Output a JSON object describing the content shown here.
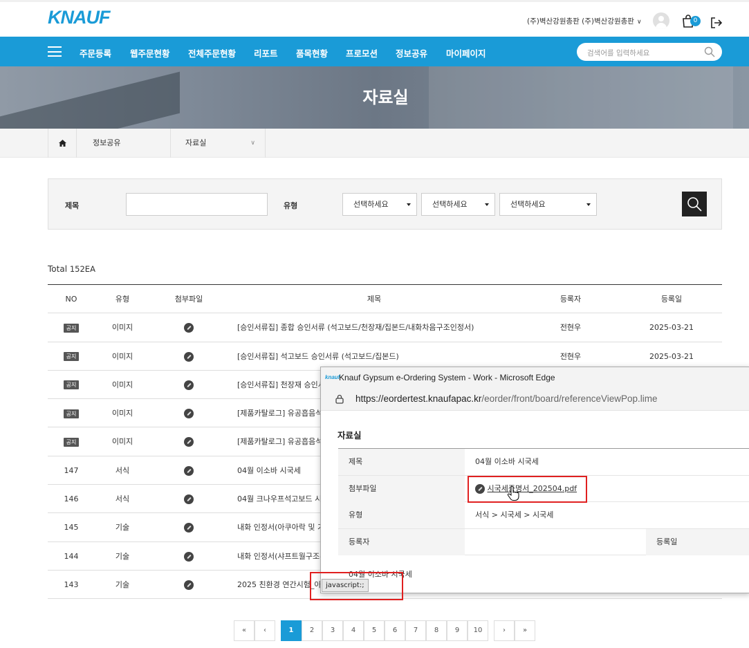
{
  "header": {
    "logo": "KNAUF",
    "account": "(주)벽산강원총판 (주)벽산강원총판",
    "cart_count": "0"
  },
  "nav": {
    "items": [
      "주문등록",
      "웹주문현황",
      "전체주문현황",
      "리포트",
      "품목현황",
      "프로모션",
      "정보공유",
      "마이페이지"
    ],
    "search_placeholder": "검색어를 입력하세요"
  },
  "hero": {
    "title": "자료실"
  },
  "breadcrumb": {
    "level1": "정보공유",
    "level2": "자료실"
  },
  "filter": {
    "title_label": "제목",
    "type_label": "유형",
    "selects": [
      "선택하세요",
      "선택하세요",
      "선택하세요"
    ]
  },
  "list": {
    "total_label": "Total",
    "total_value": "152EA",
    "headers": {
      "no": "NO",
      "type": "유형",
      "file": "첨부파일",
      "title": "제목",
      "author": "등록자",
      "date": "등록일"
    },
    "rows": [
      {
        "no": "공지",
        "notice": true,
        "type": "이미지",
        "title": "[승인서류집] 종합 승인서류 (석고보드/천장재/집본드/내화차음구조인정서)",
        "author": "전현우",
        "date": "2025-03-21"
      },
      {
        "no": "공지",
        "notice": true,
        "type": "이미지",
        "title": "[승인서류집] 석고보드 승인서류 (석고보드/집본드)",
        "author": "전현우",
        "date": "2025-03-21"
      },
      {
        "no": "공지",
        "notice": true,
        "type": "이미지",
        "title": "[승인서류집] 천장재 승인서",
        "author": "",
        "date": ""
      },
      {
        "no": "공지",
        "notice": true,
        "type": "이미지",
        "title": "[제품카탈로그] 유공흡음석",
        "author": "",
        "date": ""
      },
      {
        "no": "공지",
        "notice": true,
        "type": "이미지",
        "title": "[제품카탈로그] 유공흡음석",
        "author": "",
        "date": ""
      },
      {
        "no": "147",
        "notice": false,
        "type": "서식",
        "title": "04월 이소바 시국세",
        "author": "",
        "date": ""
      },
      {
        "no": "146",
        "notice": false,
        "type": "서식",
        "title": "04월 크나우프석고보드 시",
        "author": "",
        "date": ""
      },
      {
        "no": "145",
        "notice": false,
        "type": "기술",
        "title": "내화 인정서(아쿠아락 및 기",
        "author": "",
        "date": ""
      },
      {
        "no": "144",
        "notice": false,
        "type": "기술",
        "title": "내화 인정서(샤프트월구조-",
        "author": "",
        "date": ""
      },
      {
        "no": "143",
        "notice": false,
        "type": "기술",
        "title": "2025 친환경 연간시험_아",
        "author": "",
        "date": ""
      }
    ]
  },
  "pager": {
    "pages": [
      "1",
      "2",
      "3",
      "4",
      "5",
      "6",
      "7",
      "8",
      "9",
      "10"
    ],
    "first": "«",
    "prev": "‹",
    "next": "›",
    "last": "»"
  },
  "popup": {
    "window_title": "Knauf Gypsum e-Ordering System - Work - Microsoft Edge",
    "url_host": "https://eordertest.knaufapac.kr",
    "url_path": "/eorder/front/board/referenceViewPop.lime",
    "heading": "자료실",
    "fields": {
      "title_label": "제목",
      "title_value": "04월 이소바 시국세",
      "file_label": "첨부파일",
      "file_value": "시국세증명서_202504.pdf",
      "type_label": "유형",
      "type_value": "서식 > 시국세 > 시국세",
      "author_label": "등록자",
      "author_value": "",
      "date_label": "등록일"
    },
    "content": "04월 이소바 시국세"
  },
  "status_tooltip": "javascript:;",
  "colors": {
    "brand": "#1a9bd7",
    "highlight": "#e02020"
  }
}
